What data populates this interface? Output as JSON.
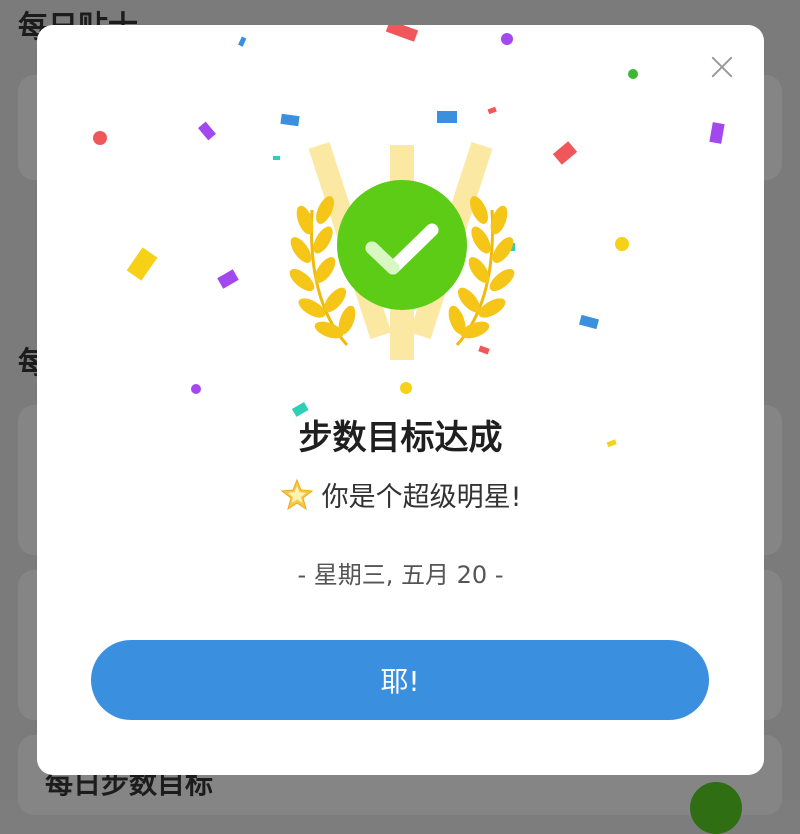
{
  "background": {
    "heading_top": "每日贴士",
    "heading_mid": "每",
    "heading_bottom": "每日步数目标"
  },
  "dialog": {
    "title": "步数目标达成",
    "subtitle": "你是个超级明星!",
    "subtitle_icon": "glowing-star-icon",
    "date": "- 星期三, 五月 20 -",
    "button_label": "耶!",
    "close_icon": "close-icon",
    "badge_icon": "checkmark-laurel-badge-icon"
  },
  "colors": {
    "accent_blue": "#3b8fdf",
    "check_green": "#5ccc17",
    "laurel_gold": "#f5c518",
    "overlay": "#7b7b7b"
  }
}
